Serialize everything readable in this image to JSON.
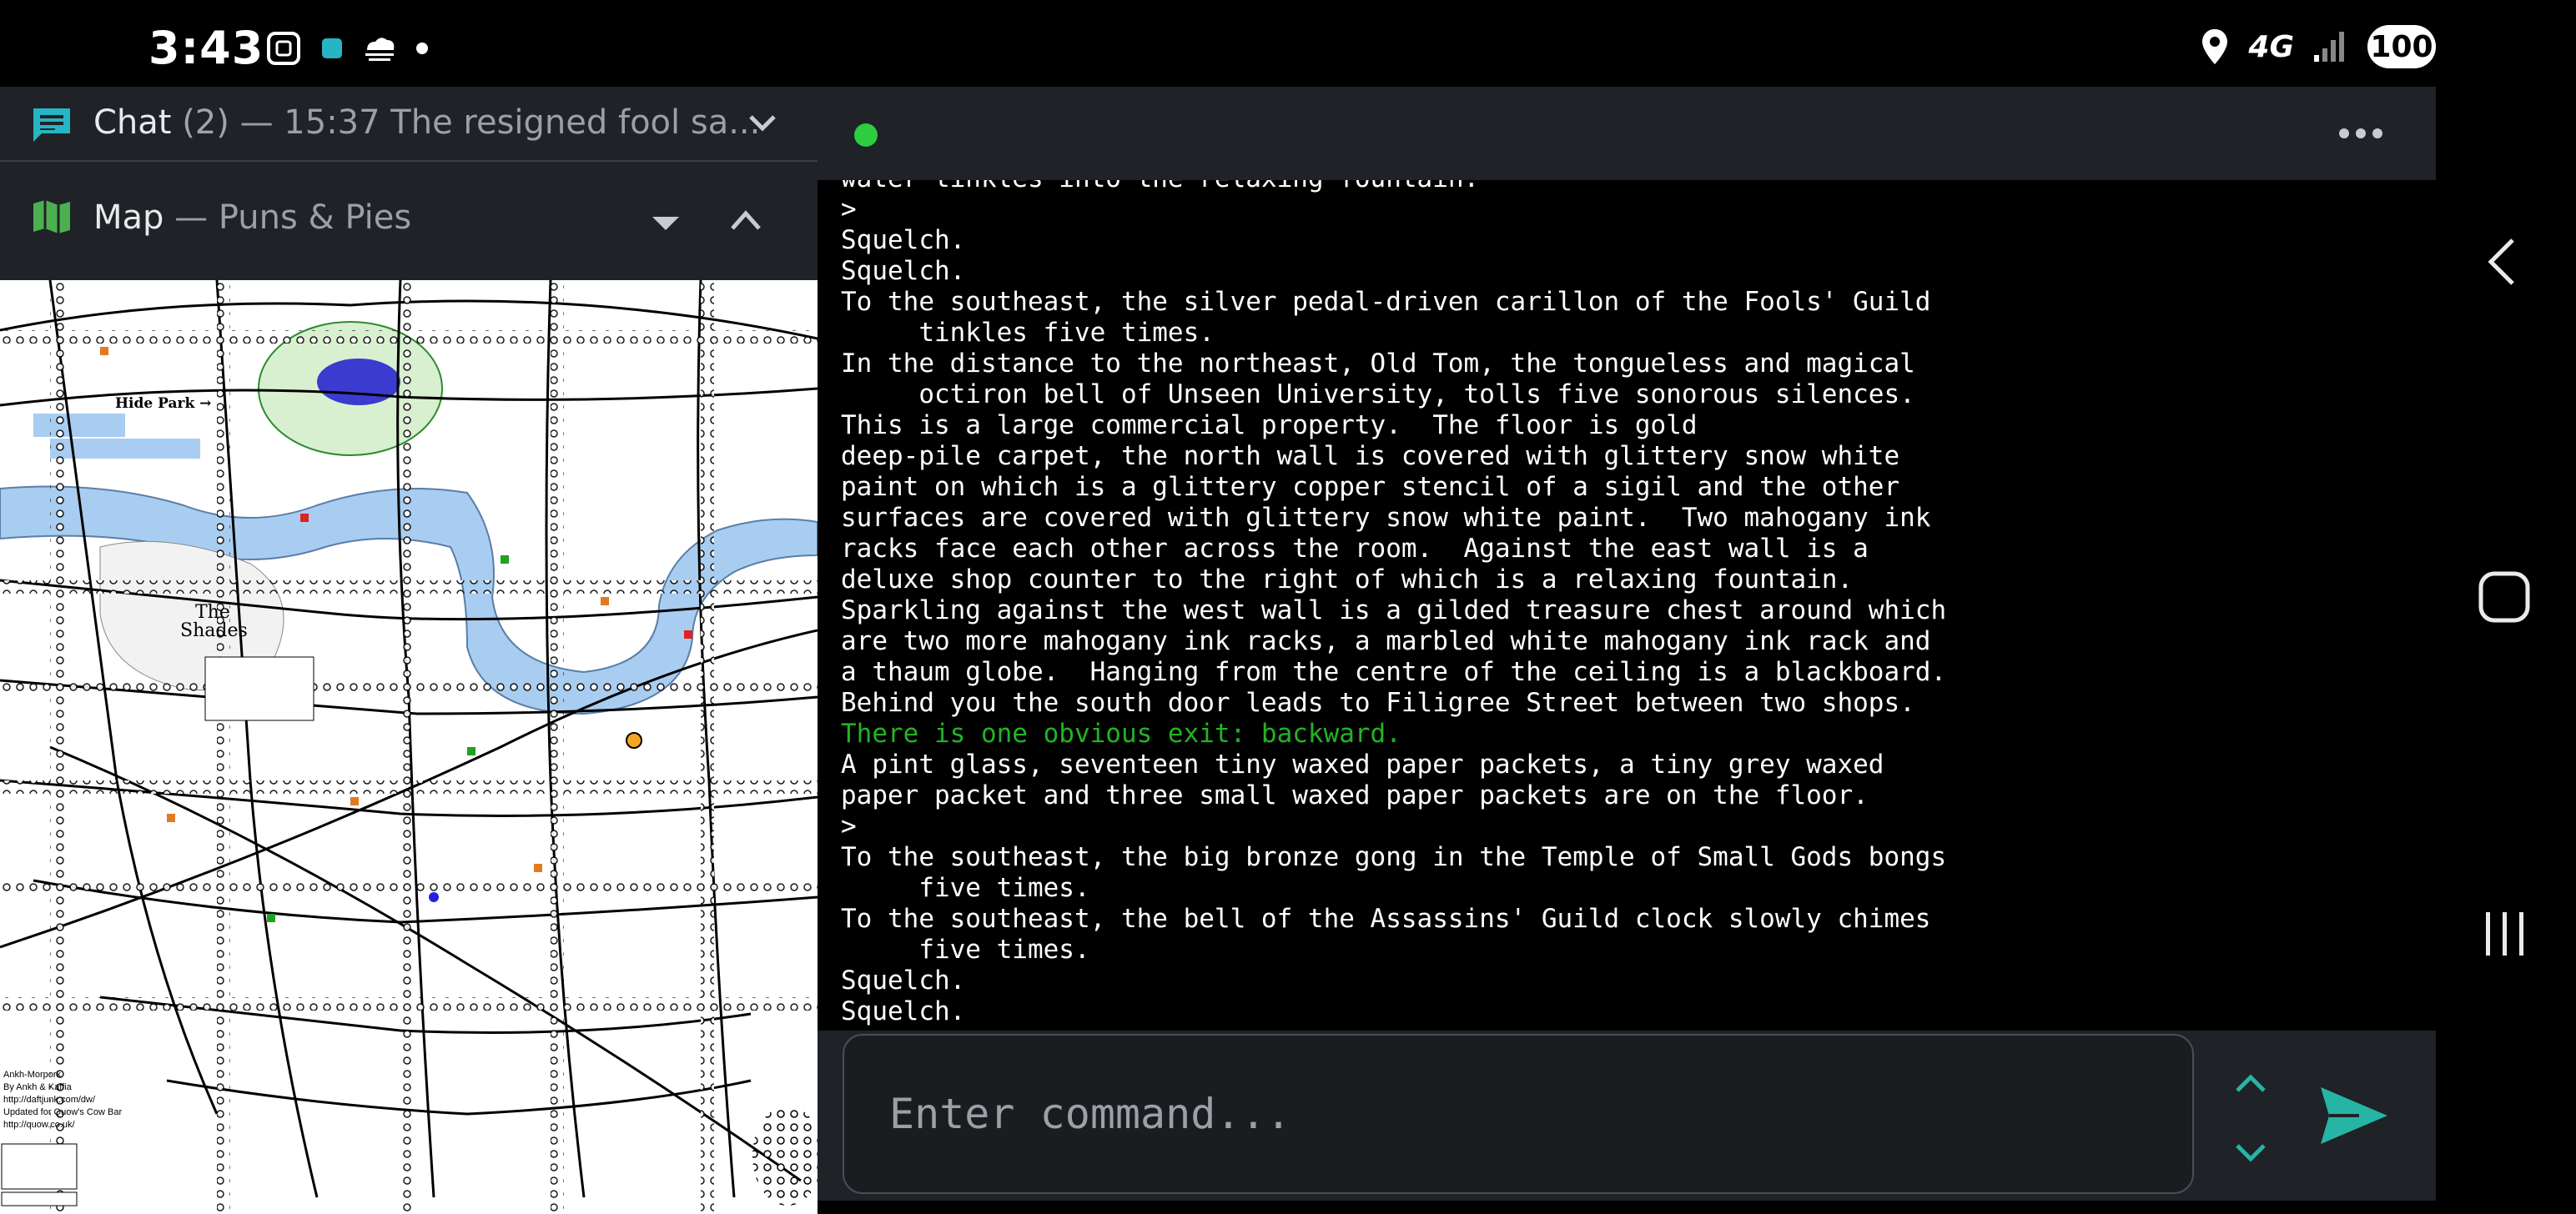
{
  "status_bar": {
    "time": "3:43",
    "network": "4G",
    "battery": "100",
    "icons": [
      "screenshot-icon",
      "app-icon",
      "weather-icon",
      "dot-icon",
      "location-icon",
      "signal-icon"
    ]
  },
  "chat_panel": {
    "title": "Chat",
    "count": "(2)",
    "latest": "— 15:37 The resigned fool sa..."
  },
  "map_panel": {
    "title": "Map",
    "subtitle": "— Puns & Pies",
    "labels": {
      "hide_park": "Hide Park →",
      "the": "The",
      "shades": "Shades"
    },
    "credits": [
      "Ankh-Morpork",
      "By Ankh & Kaffia",
      "http://daftjunk.com/dw/",
      "Updated for Quow's Cow Bar",
      "http://quow.co.uk/"
    ]
  },
  "terminal": {
    "status_color": "#2ecc40",
    "lines": [
      {
        "text": "water tinkles into the relaxing fountain.",
        "color": "default"
      },
      {
        "text": ">",
        "color": "default"
      },
      {
        "text": "Squelch.",
        "color": "default"
      },
      {
        "text": "Squelch.",
        "color": "default"
      },
      {
        "text": "To the southeast, the silver pedal-driven carillon of the Fools' Guild",
        "color": "default"
      },
      {
        "text": "     tinkles five times.",
        "color": "default"
      },
      {
        "text": "In the distance to the northeast, Old Tom, the tongueless and magical",
        "color": "default"
      },
      {
        "text": "     octiron bell of Unseen University, tolls five sonorous silences.",
        "color": "default"
      },
      {
        "text": "This is a large commercial property.  The floor is gold",
        "color": "default"
      },
      {
        "text": "deep-pile carpet, the north wall is covered with glittery snow white",
        "color": "default"
      },
      {
        "text": "paint on which is a glittery copper stencil of a sigil and the other",
        "color": "default"
      },
      {
        "text": "surfaces are covered with glittery snow white paint.  Two mahogany ink",
        "color": "default"
      },
      {
        "text": "racks face each other across the room.  Against the east wall is a",
        "color": "default"
      },
      {
        "text": "deluxe shop counter to the right of which is a relaxing fountain.",
        "color": "default"
      },
      {
        "text": "Sparkling against the west wall is a gilded treasure chest around which",
        "color": "default"
      },
      {
        "text": "are two more mahogany ink racks, a marbled white mahogany ink rack and",
        "color": "default"
      },
      {
        "text": "a thaum globe.  Hanging from the centre of the ceiling is a blackboard.",
        "color": "default"
      },
      {
        "text": "Behind you the south door leads to Filigree Street between two shops.",
        "color": "default"
      },
      {
        "text": "There is one obvious exit: backward.",
        "color": "green"
      },
      {
        "text": "A pint glass, seventeen tiny waxed paper packets, a tiny grey waxed",
        "color": "default"
      },
      {
        "text": "paper packet and three small waxed paper packets are on the floor.",
        "color": "default"
      },
      {
        "text": ">",
        "color": "default"
      },
      {
        "text": "To the southeast, the big bronze gong in the Temple of Small Gods bongs",
        "color": "default"
      },
      {
        "text": "     five times.",
        "color": "default"
      },
      {
        "text": "To the southeast, the bell of the Assassins' Guild clock slowly chimes",
        "color": "default"
      },
      {
        "text": "     five times.",
        "color": "default"
      },
      {
        "text": "Squelch.",
        "color": "default"
      },
      {
        "text": "Squelch.",
        "color": "default"
      }
    ]
  },
  "input": {
    "placeholder": "Enter command...",
    "value": ""
  },
  "colors": {
    "panel_bg": "#1f2226",
    "accent_teal": "#26b5a5",
    "map_icon": "#4caf50",
    "water": "#a8cdf0"
  }
}
